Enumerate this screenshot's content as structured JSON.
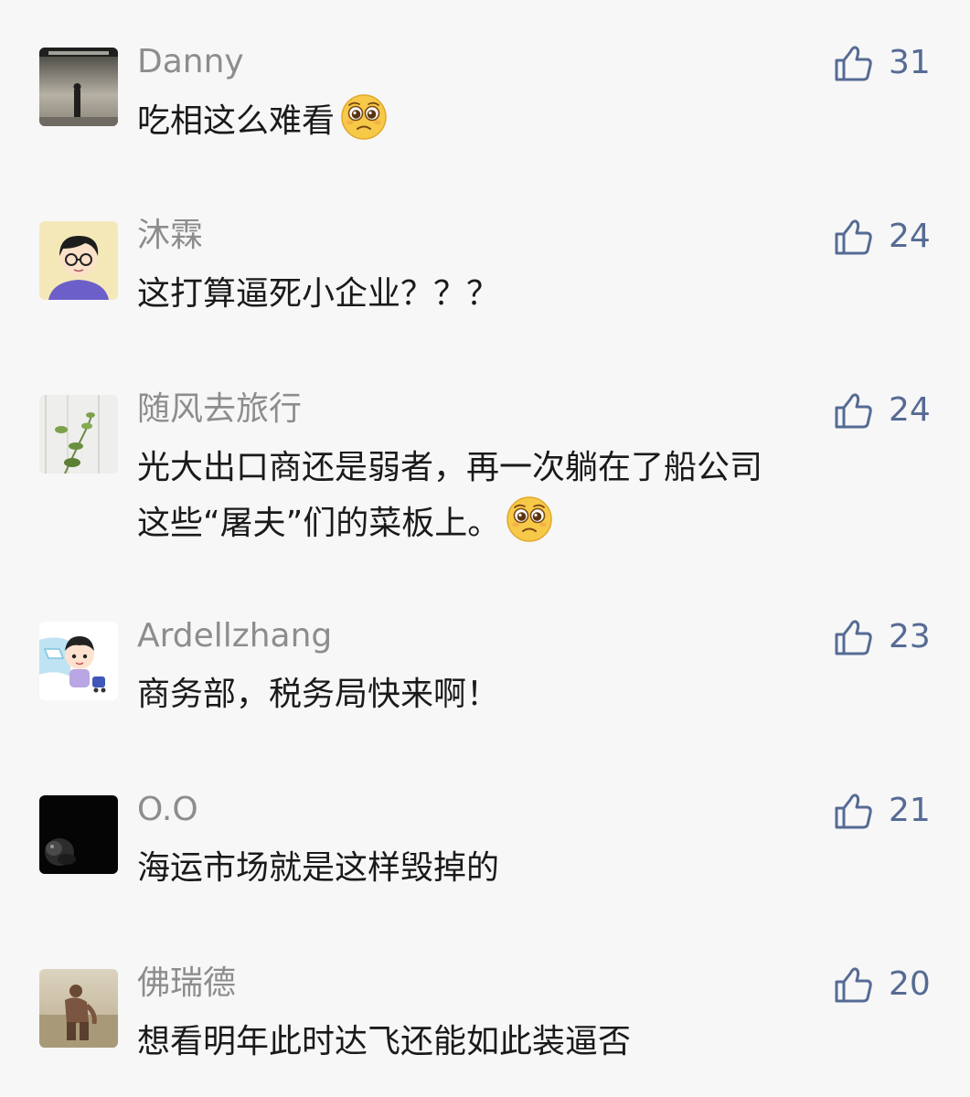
{
  "colors": {
    "background": "#f7f7f7",
    "username": "#8d8d8d",
    "text": "#1a1a1a",
    "like_accent": "#566b94"
  },
  "comments": [
    {
      "username": "Danny",
      "text": "吃相这么难看",
      "likes": "31",
      "emoji": "pleading-face-icon"
    },
    {
      "username": "沐霖",
      "text": "这打算逼死小企业？？？",
      "likes": "24"
    },
    {
      "username": "随风去旅行",
      "text": "光大出口商还是弱者，再一次躺在了船公司\n这些“屠夫”们的菜板上。",
      "likes": "24",
      "emoji": "pleading-face-icon"
    },
    {
      "username": "Ardellzhang",
      "text": "商务部，税务局快来啊！",
      "likes": "23"
    },
    {
      "username": "O.O",
      "text": "海运市场就是这样毁掉的",
      "likes": "21"
    },
    {
      "username": "佛瑞德",
      "text": "想看明年此时达飞还能如此装逼否",
      "likes": "20"
    }
  ]
}
